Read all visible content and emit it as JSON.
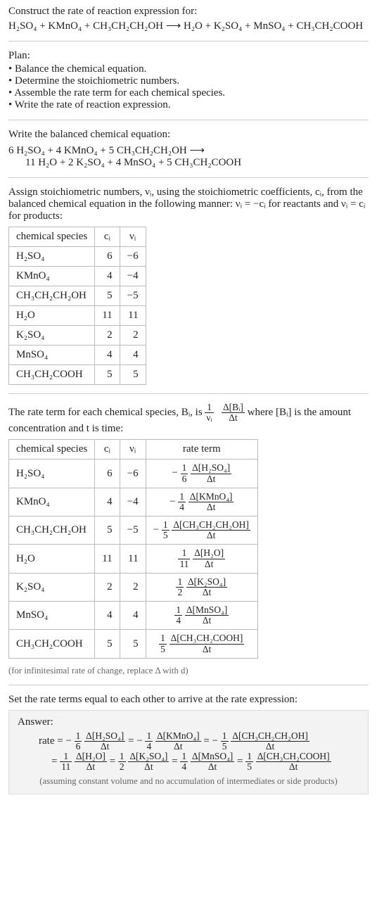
{
  "intro": {
    "title": "Construct the rate of reaction expression for:",
    "equation": "H₂SO₄ + KMnO₄ + CH₃CH₂CH₂OH ⟶ H₂O + K₂SO₄ + MnSO₄ + CH₃CH₂COOH"
  },
  "plan": {
    "label": "Plan:",
    "items": [
      "Balance the chemical equation.",
      "Determine the stoichiometric numbers.",
      "Assemble the rate term for each chemical species.",
      "Write the rate of reaction expression."
    ]
  },
  "balanced": {
    "title": "Write the balanced chemical equation:",
    "line1": "6 H₂SO₄ + 4 KMnO₄ + 5 CH₃CH₂CH₂OH ⟶",
    "line2": "11 H₂O + 2 K₂SO₄ + 4 MnSO₄ + 5 CH₃CH₂COOH"
  },
  "stoich_text": "Assign stoichiometric numbers, νᵢ, using the stoichiometric coefficients, cᵢ, from the balanced chemical equation in the following manner: νᵢ = −cᵢ for reactants and νᵢ = cᵢ for products:",
  "table1": {
    "headers": [
      "chemical species",
      "cᵢ",
      "νᵢ"
    ],
    "rows": [
      [
        "H₂SO₄",
        "6",
        "−6"
      ],
      [
        "KMnO₄",
        "4",
        "−4"
      ],
      [
        "CH₃CH₂CH₂OH",
        "5",
        "−5"
      ],
      [
        "H₂O",
        "11",
        "11"
      ],
      [
        "K₂SO₄",
        "2",
        "2"
      ],
      [
        "MnSO₄",
        "4",
        "4"
      ],
      [
        "CH₃CH₂COOH",
        "5",
        "5"
      ]
    ]
  },
  "rate_term_text_a": "The rate term for each chemical species, Bᵢ, is ",
  "rate_term_frac_top": "1",
  "rate_term_frac_bot": "νᵢ",
  "rate_term_frac2_top": "Δ[Bᵢ]",
  "rate_term_frac2_bot": "Δt",
  "rate_term_text_b": " where [Bᵢ] is the amount concentration and t is time:",
  "table2": {
    "headers": [
      "chemical species",
      "cᵢ",
      "νᵢ",
      "rate term"
    ],
    "rows": [
      {
        "sp": "H₂SO₄",
        "c": "6",
        "v": "−6",
        "sign": "−",
        "a": "1",
        "b": "6",
        "top": "Δ[H₂SO₄]",
        "bot": "Δt"
      },
      {
        "sp": "KMnO₄",
        "c": "4",
        "v": "−4",
        "sign": "−",
        "a": "1",
        "b": "4",
        "top": "Δ[KMnO₄]",
        "bot": "Δt"
      },
      {
        "sp": "CH₃CH₂CH₂OH",
        "c": "5",
        "v": "−5",
        "sign": "−",
        "a": "1",
        "b": "5",
        "top": "Δ[CH₃CH₂CH₂OH]",
        "bot": "Δt"
      },
      {
        "sp": "H₂O",
        "c": "11",
        "v": "11",
        "sign": "",
        "a": "1",
        "b": "11",
        "top": "Δ[H₂O]",
        "bot": "Δt"
      },
      {
        "sp": "K₂SO₄",
        "c": "2",
        "v": "2",
        "sign": "",
        "a": "1",
        "b": "2",
        "top": "Δ[K₂SO₄]",
        "bot": "Δt"
      },
      {
        "sp": "MnSO₄",
        "c": "4",
        "v": "4",
        "sign": "",
        "a": "1",
        "b": "4",
        "top": "Δ[MnSO₄]",
        "bot": "Δt"
      },
      {
        "sp": "CH₃CH₂COOH",
        "c": "5",
        "v": "5",
        "sign": "",
        "a": "1",
        "b": "5",
        "top": "Δ[CH₃CH₂COOH]",
        "bot": "Δt"
      }
    ]
  },
  "table2_caption": "(for infinitesimal rate of change, replace Δ with d)",
  "set_equal_text": "Set the rate terms equal to each other to arrive at the rate expression:",
  "answer": {
    "label": "Answer:",
    "prefix": "rate = ",
    "terms": [
      {
        "sign": "−",
        "a": "1",
        "b": "6",
        "top": "Δ[H₂SO₄]",
        "bot": "Δt"
      },
      {
        "sign": "−",
        "a": "1",
        "b": "4",
        "top": "Δ[KMnO₄]",
        "bot": "Δt"
      },
      {
        "sign": "−",
        "a": "1",
        "b": "5",
        "top": "Δ[CH₃CH₂CH₂OH]",
        "bot": "Δt"
      },
      {
        "sign": "",
        "a": "1",
        "b": "11",
        "top": "Δ[H₂O]",
        "bot": "Δt"
      },
      {
        "sign": "",
        "a": "1",
        "b": "2",
        "top": "Δ[K₂SO₄]",
        "bot": "Δt"
      },
      {
        "sign": "",
        "a": "1",
        "b": "4",
        "top": "Δ[MnSO₄]",
        "bot": "Δt"
      },
      {
        "sign": "",
        "a": "1",
        "b": "5",
        "top": "Δ[CH₃CH₂COOH]",
        "bot": "Δt"
      }
    ],
    "footnote": "(assuming constant volume and no accumulation of intermediates or side products)"
  }
}
